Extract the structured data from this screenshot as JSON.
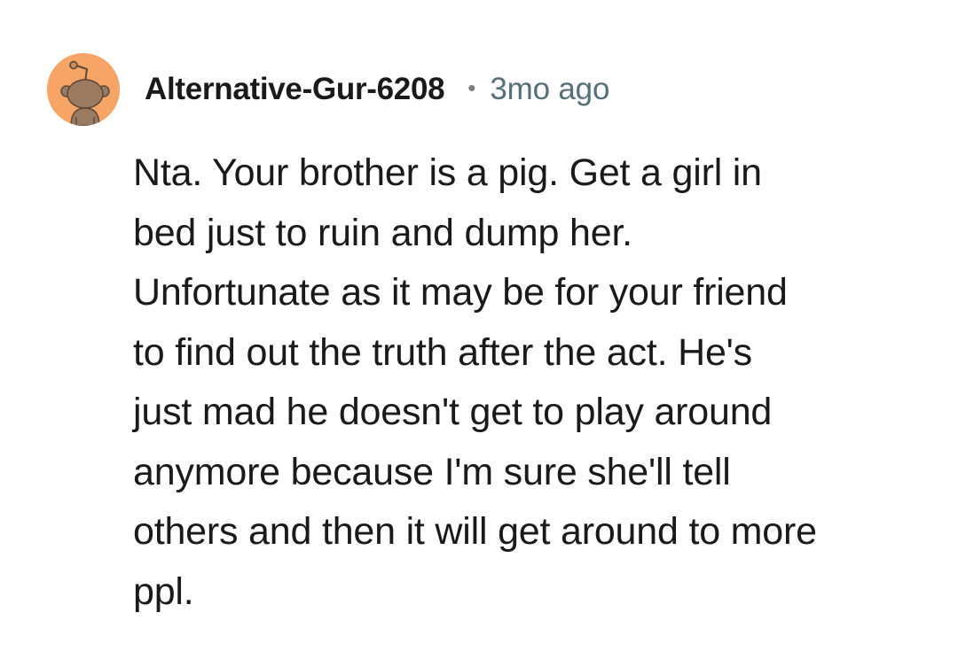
{
  "comment": {
    "avatar_icon": "snoo-avatar-icon",
    "avatar_color": "#f6a567",
    "username": "Alternative-Gur-6208",
    "separator": "•",
    "timestamp": "3mo ago",
    "body_lines": [
      "Nta. Your brother is a pig. Get a girl in",
      "bed just to ruin and dump her.",
      "Unfortunate as it may be for your friend",
      "to find out the truth after the act. He's",
      "just mad he doesn't get to play around",
      "anymore because I'm sure she'll tell",
      "others and then it will get around to more",
      "ppl."
    ]
  }
}
